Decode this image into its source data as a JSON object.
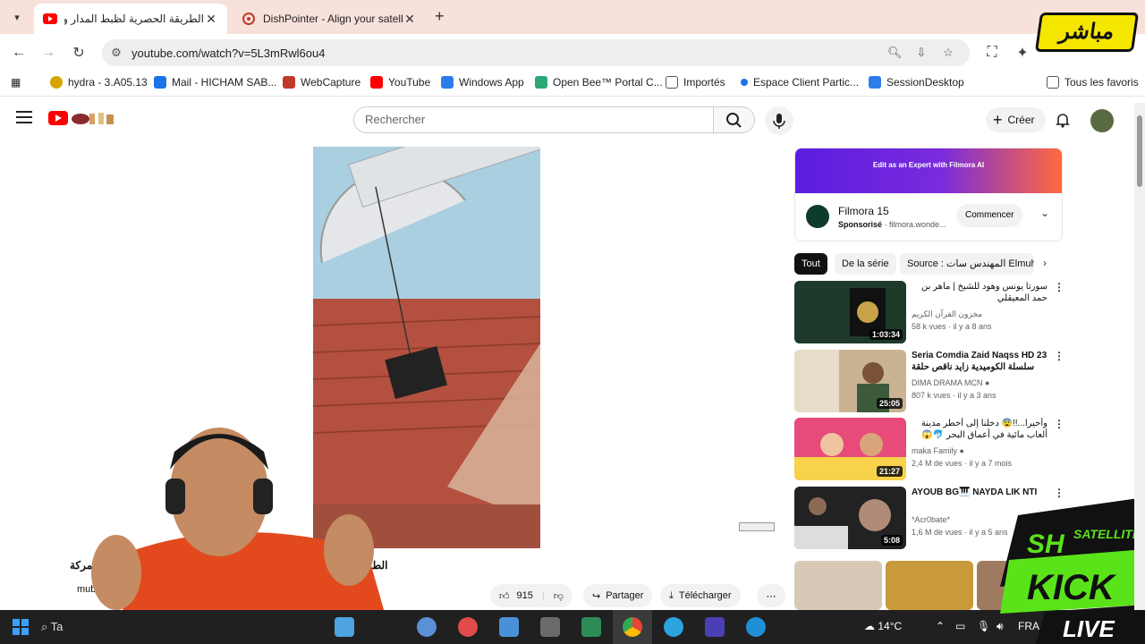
{
  "browser": {
    "tabs": [
      {
        "title": "الطريقة الحصرية لظبط المدار وظ",
        "active": true,
        "favicon": "youtube-icon"
      },
      {
        "title": "DishPointer - Align your satellit",
        "active": false,
        "favicon": "dishpointer-icon"
      }
    ],
    "url": "youtube.com/watch?v=5L3mRwl6ou4",
    "bookmarks": [
      {
        "label": "hydra - 3.A05.13",
        "color": "#d6a600"
      },
      {
        "label": "Mail - HICHAM SAB...",
        "color": "#1a73e8"
      },
      {
        "label": "WebCapture",
        "color": "#c0392b"
      },
      {
        "label": "YouTube",
        "color": "#ff0000"
      },
      {
        "label": "Windows App",
        "color": "#2b7de9"
      },
      {
        "label": "Open Bee™ Portal C...",
        "color": "#2aa876"
      },
      {
        "label": "Importés",
        "color": "#555555"
      },
      {
        "label": "Espace Client Partic...",
        "color": "#1a73e8"
      },
      {
        "label": "SessionDesktop",
        "color": "#2b7de9"
      }
    ],
    "all_bookmarks": "Tous les favoris"
  },
  "youtube": {
    "search_placeholder": "Rechercher",
    "create_label": "Créer",
    "video": {
      "title_part1": "الإطاحة المركة",
      "title_part2": "الطر",
      "channel": "mub",
      "likes": "915",
      "share_label": "Partager",
      "download_label": "Télécharger"
    },
    "ad": {
      "banner_text": "Edit as an Expert with Filmora AI",
      "title": "Filmora 15",
      "sponsored": "Sponsorisé",
      "domain": "filmora.wonde...",
      "cta": "Commencer"
    },
    "chips": [
      "Tout",
      "De la série",
      "Source : المهندس سات Elmuhand"
    ],
    "recommendations": [
      {
        "title": "سورتا يونس وهود للشيخ | ماهر بن حمد المعيقلي",
        "channel": "مخزون القرآن الكريم",
        "meta": "58 k vues · il y a 8 ans",
        "duration": "1:03:34",
        "thumb": "#1f3a2c"
      },
      {
        "title": "Seria Comdia Zaid Naqss HD 23 سلسلة الكوميدية زايد ناقص حلقة",
        "channel": "DIMA DRAMA MCN",
        "meta": "807 k vues · il y a 3 ans",
        "duration": "25:05",
        "thumb": "#8a6a48"
      },
      {
        "title": "وأخيرا...!!😨 دخلنا إلى أخطر مدينة ألعاب مائية في أعماق البحر 🐬😱 (رابي",
        "channel": "maka Family",
        "meta": "2,4 M de vues · il y a 7 mois",
        "duration": "21:27",
        "thumb": "#e0406a"
      },
      {
        "title": "AYOUB BG🎹 NAYDA LIK NTI",
        "channel": "*Acr0bate*",
        "meta": "1,6 M de vues · il y a 5 ans",
        "duration": "5:08",
        "thumb": "#2a2a2a"
      }
    ]
  },
  "taskbar": {
    "search_label": "Ta",
    "weather": "14°C",
    "lang": "FRA"
  },
  "overlays": {
    "mobasher": "مباشر",
    "brand_top": "SH SATELLITE",
    "brand_mid": "KICK",
    "brand_bot": "LIVE"
  }
}
